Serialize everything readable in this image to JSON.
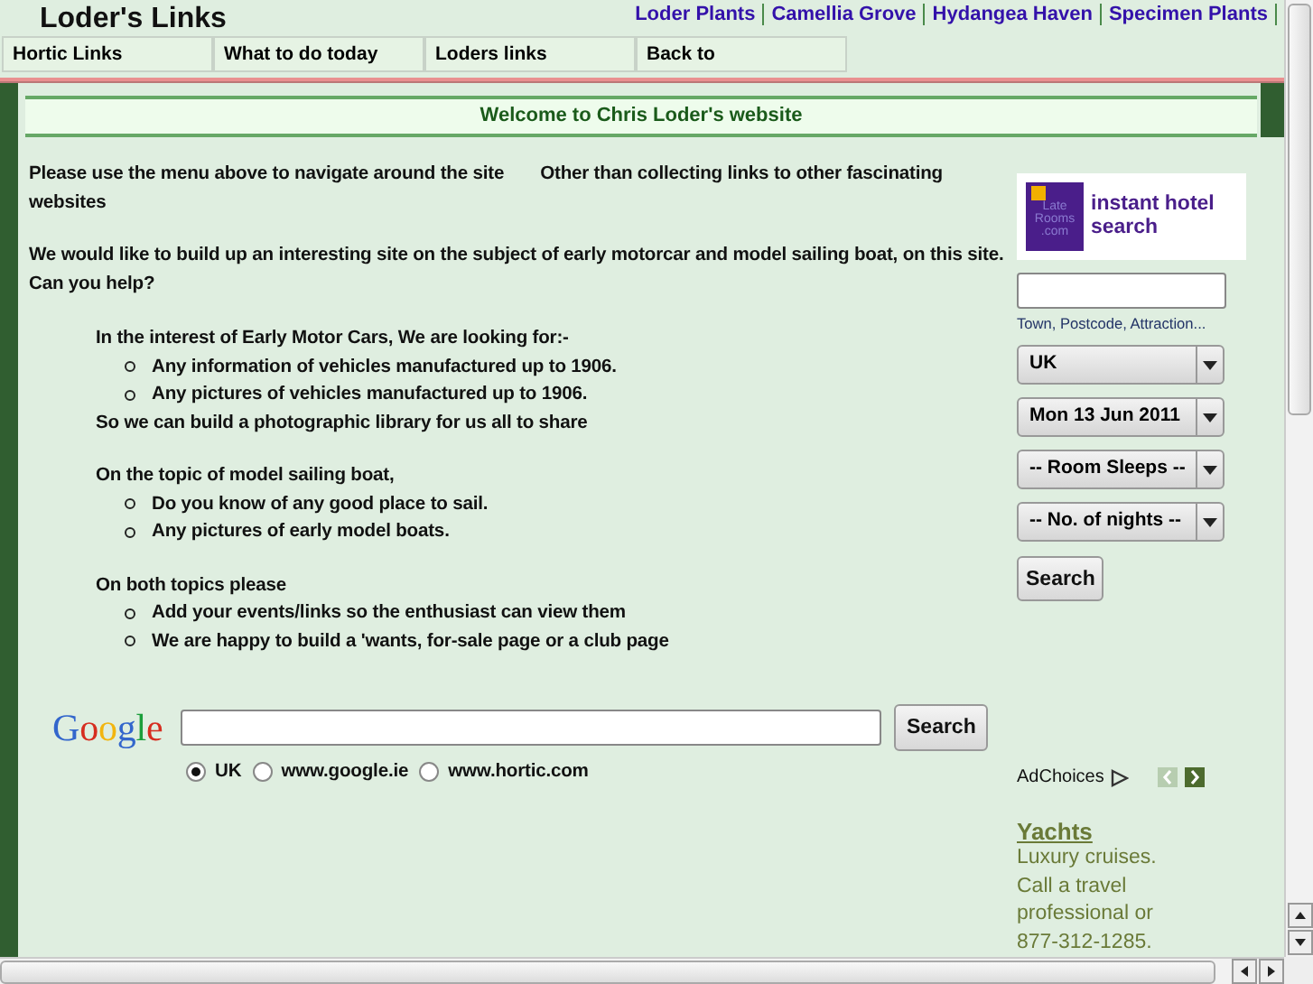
{
  "header": {
    "title": "Loder's Links",
    "top_links": [
      "Loder Plants",
      "Camellia Grove",
      "Hydangea Haven",
      "Specimen Plants"
    ],
    "menu": [
      "Hortic Links",
      "What to do today",
      "Loders links",
      "Back to"
    ]
  },
  "welcome": "Welcome to Chris Loder's website",
  "intro": {
    "lead": "Please use the menu above to navigate around the site",
    "rest": "Other than collecting links to other fascinating websites"
  },
  "appeal": "We would like to build up an interesting site on the subject of early motorcar and model sailing boat, on this site. Can you help?",
  "sections": [
    {
      "heading": "In the interest of Early Motor Cars, We are looking for:-",
      "items": [
        "Any information of vehicles manufactured up to 1906.",
        "Any pictures of vehicles manufactured up to 1906."
      ],
      "footer": "So we can build a photographic library for us all to share"
    },
    {
      "heading": "On the topic of model sailing boat,",
      "items": [
        "Do you know of any good place to sail.",
        "Any pictures of early model boats."
      ]
    },
    {
      "heading": "On both topics please",
      "items": [
        "Add your events/links so the enthusiast can view them",
        "We are happy to build a 'wants, for-sale page or a club page"
      ]
    }
  ],
  "google": {
    "logo": "Google",
    "search_button": "Search",
    "options": [
      {
        "label": "UK",
        "selected": true
      },
      {
        "label": "www.google.ie",
        "selected": false
      },
      {
        "label": "www.hortic.com",
        "selected": false
      }
    ]
  },
  "hotel": {
    "logo_text": "Late Rooms .com",
    "tagline": "instant hotel search",
    "field_hint": "Town, Postcode, Attraction...",
    "selects": [
      "UK",
      "Mon 13 Jun 2011",
      "-- Room Sleeps --",
      "-- No. of nights --"
    ],
    "search_button": "Search"
  },
  "ad": {
    "adchoices": "AdChoices",
    "title": "Yachts",
    "body": "Luxury cruises. Call a travel professional or 877-312-1285."
  }
}
